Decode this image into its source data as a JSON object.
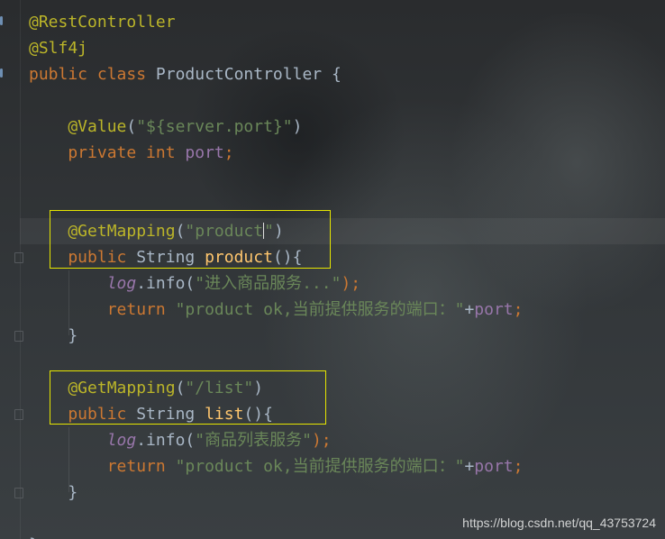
{
  "code_lines": [
    {
      "segments": [
        {
          "t": "@RestController",
          "c": "annot"
        }
      ]
    },
    {
      "segments": [
        {
          "t": "@Slf4j",
          "c": "annot"
        }
      ]
    },
    {
      "segments": [
        {
          "t": "public ",
          "c": "kw"
        },
        {
          "t": "class ",
          "c": "kw"
        },
        {
          "t": "ProductController {",
          "c": "plain"
        }
      ]
    },
    {
      "segments": []
    },
    {
      "segments": [
        {
          "t": "    @Value",
          "c": "annot"
        },
        {
          "t": "(",
          "c": "plain"
        },
        {
          "t": "\"${server.port}\"",
          "c": "str"
        },
        {
          "t": ")",
          "c": "plain"
        }
      ]
    },
    {
      "segments": [
        {
          "t": "    private ",
          "c": "kw"
        },
        {
          "t": "int ",
          "c": "kw"
        },
        {
          "t": "port",
          "c": "fld"
        },
        {
          "t": ";",
          "c": "kw"
        }
      ]
    },
    {
      "segments": []
    },
    {
      "segments": []
    },
    {
      "segments": [
        {
          "t": "    @GetMapping",
          "c": "annot"
        },
        {
          "t": "(",
          "c": "plain"
        },
        {
          "t": "\"product",
          "c": "str"
        },
        {
          "t": "|caret|",
          "c": "caret"
        },
        {
          "t": "\"",
          "c": "str"
        },
        {
          "t": ")",
          "c": "plain"
        }
      ]
    },
    {
      "segments": [
        {
          "t": "    public ",
          "c": "kw"
        },
        {
          "t": "String ",
          "c": "plain"
        },
        {
          "t": "product",
          "c": "meth"
        },
        {
          "t": "(){",
          "c": "plain"
        }
      ]
    },
    {
      "segments": [
        {
          "t": "        log",
          "c": "ital"
        },
        {
          "t": ".info(",
          "c": "plain"
        },
        {
          "t": "\"进入商品服务...\"",
          "c": "str"
        },
        {
          "t": ");",
          "c": "kw"
        }
      ]
    },
    {
      "segments": [
        {
          "t": "        return ",
          "c": "kw"
        },
        {
          "t": "\"product ok,当前提供服务的端口：\"",
          "c": "str"
        },
        {
          "t": "+",
          "c": "plain"
        },
        {
          "t": "port",
          "c": "fld"
        },
        {
          "t": ";",
          "c": "kw"
        }
      ]
    },
    {
      "segments": [
        {
          "t": "    }",
          "c": "plain"
        }
      ]
    },
    {
      "segments": []
    },
    {
      "segments": [
        {
          "t": "    @GetMapping",
          "c": "annot"
        },
        {
          "t": "(",
          "c": "plain"
        },
        {
          "t": "\"/list\"",
          "c": "str"
        },
        {
          "t": ")",
          "c": "plain"
        }
      ]
    },
    {
      "segments": [
        {
          "t": "    public ",
          "c": "kw"
        },
        {
          "t": "String ",
          "c": "plain"
        },
        {
          "t": "list",
          "c": "meth"
        },
        {
          "t": "(){",
          "c": "plain"
        }
      ]
    },
    {
      "segments": [
        {
          "t": "        log",
          "c": "ital"
        },
        {
          "t": ".info(",
          "c": "plain"
        },
        {
          "t": "\"商品列表服务\"",
          "c": "str"
        },
        {
          "t": ");",
          "c": "kw"
        }
      ]
    },
    {
      "segments": [
        {
          "t": "        return ",
          "c": "kw"
        },
        {
          "t": "\"product ok,当前提供服务的端口：\"",
          "c": "str"
        },
        {
          "t": "+",
          "c": "plain"
        },
        {
          "t": "port",
          "c": "fld"
        },
        {
          "t": ";",
          "c": "kw"
        }
      ]
    },
    {
      "segments": [
        {
          "t": "    }",
          "c": "plain"
        }
      ]
    },
    {
      "segments": []
    },
    {
      "segments": [
        {
          "t": "}",
          "c": "plain"
        }
      ]
    }
  ],
  "colors": {
    "annotation": "#bbb529",
    "keyword": "#cc7832",
    "string": "#6a8759",
    "field": "#9876aa",
    "method": "#ffc66d",
    "default": "#a9b7c6",
    "highlight_box": "#e6e600"
  },
  "watermark": "https://blog.csdn.net/qq_43753724"
}
